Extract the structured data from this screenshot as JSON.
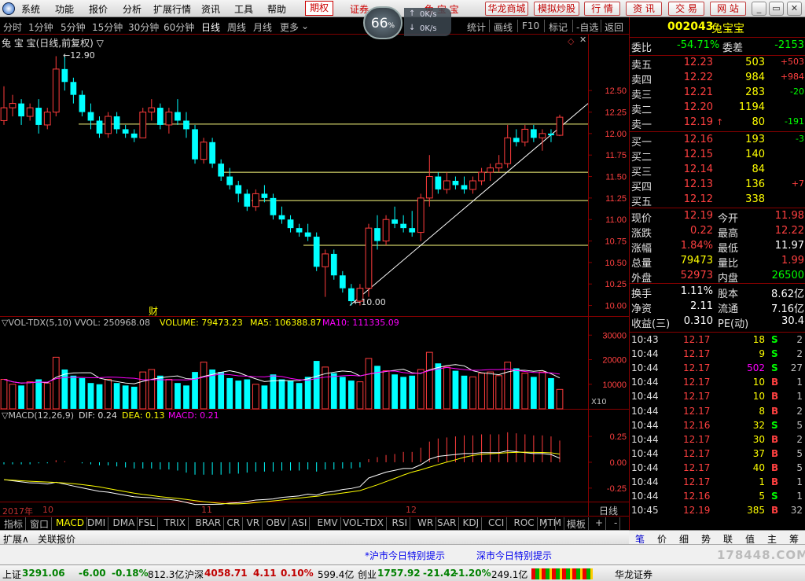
{
  "menu": [
    "系统",
    "功能",
    "报价",
    "分析",
    "扩展行情",
    "资讯",
    "工具",
    "帮助"
  ],
  "menu_highlight": "期权",
  "menu_scroll": "证券",
  "menu_stock": "兔 宝 宝",
  "top_buttons": [
    "华龙商城",
    "模拟炒股",
    "行 情",
    "资 讯",
    "交 易",
    "网 站"
  ],
  "speed": {
    "percent": "66",
    "unit": "%",
    "up": "0K/s",
    "down": "0K/s",
    "tip": "模拟"
  },
  "periods": [
    "分时",
    "1分钟",
    "5分钟",
    "15分钟",
    "30分钟",
    "60分钟",
    "日线",
    "周线",
    "月线",
    "更多"
  ],
  "period_active": "日线",
  "right_tools": [
    "统计",
    "画线",
    "F10",
    "标记",
    "-自选",
    "返回"
  ],
  "chart_title": "兔 宝 宝(日线,前复权) ▽",
  "price_hi_label": "12.90",
  "price_lo_label": "10.00",
  "fin_mark": "财",
  "vol_title": {
    "a": "▽VOL-TDX(5,10) VVOL: 250968.08",
    "b": "VOLUME: 79473.23",
    "c": "MA5: 106388.87",
    "d": "MA10: 111335.09"
  },
  "vol_unit": "X10",
  "macd_title": {
    "a": "▽MACD(12,26,9)",
    "b": "DIF: 0.24",
    "c": "DEA: 0.13",
    "d": "MACD: 0.21"
  },
  "date_labels": {
    "year": "2017年",
    "m1": "10",
    "m2": "11",
    "m3": "12"
  },
  "timeframe_label": "日线",
  "chart_data": [
    {
      "type": "candlestick",
      "y_ticks": [
        "12.50",
        "12.25",
        "12.00",
        "11.75",
        "11.50",
        "11.25",
        "11.00",
        "10.75",
        "10.50",
        "10.25",
        "10.00"
      ],
      "ylim": [
        9.95,
        12.95
      ],
      "candles": [
        [
          12.15,
          12.55,
          12.1,
          12.3
        ],
        [
          12.3,
          12.45,
          12.2,
          12.35
        ],
        [
          12.35,
          12.4,
          12.1,
          12.2
        ],
        [
          12.2,
          12.35,
          12.15,
          12.3
        ],
        [
          12.3,
          12.4,
          12.0,
          12.1
        ],
        [
          12.1,
          12.3,
          12.05,
          12.25
        ],
        [
          12.25,
          12.9,
          12.2,
          12.75
        ],
        [
          12.75,
          12.9,
          12.5,
          12.6
        ],
        [
          12.6,
          12.65,
          12.35,
          12.45
        ],
        [
          12.45,
          12.5,
          12.2,
          12.25
        ],
        [
          12.25,
          12.35,
          12.05,
          12.15
        ],
        [
          12.15,
          12.2,
          11.95,
          12.0
        ],
        [
          12.0,
          12.25,
          11.95,
          12.2
        ],
        [
          12.2,
          12.25,
          12.0,
          12.05
        ],
        [
          12.05,
          12.1,
          11.95,
          12.0
        ],
        [
          12.0,
          12.05,
          11.9,
          11.95
        ],
        [
          11.95,
          12.3,
          11.95,
          12.25
        ],
        [
          12.25,
          12.4,
          12.15,
          12.3
        ],
        [
          12.3,
          12.35,
          12.05,
          12.1
        ],
        [
          12.1,
          12.3,
          12.0,
          12.25
        ],
        [
          12.25,
          12.4,
          12.1,
          12.15
        ],
        [
          12.15,
          12.25,
          11.95,
          12.05
        ],
        [
          12.05,
          12.1,
          11.65,
          11.7
        ],
        [
          11.7,
          11.95,
          11.65,
          11.9
        ],
        [
          11.9,
          11.95,
          11.6,
          11.65
        ],
        [
          11.65,
          11.7,
          11.45,
          11.5
        ],
        [
          11.5,
          11.6,
          11.35,
          11.4
        ],
        [
          11.4,
          11.45,
          11.2,
          11.3
        ],
        [
          11.3,
          11.35,
          11.1,
          11.15
        ],
        [
          11.15,
          11.35,
          11.1,
          11.3
        ],
        [
          11.3,
          11.4,
          11.2,
          11.25
        ],
        [
          11.25,
          11.3,
          11.0,
          11.05
        ],
        [
          11.05,
          11.15,
          10.95,
          11.0
        ],
        [
          11.0,
          11.05,
          10.85,
          10.9
        ],
        [
          10.9,
          10.95,
          10.8,
          10.85
        ],
        [
          10.85,
          10.95,
          10.75,
          10.8
        ],
        [
          10.8,
          10.85,
          10.4,
          10.45
        ],
        [
          10.45,
          10.65,
          10.1,
          10.6
        ],
        [
          10.6,
          10.65,
          10.3,
          10.35
        ],
        [
          10.35,
          10.4,
          10.15,
          10.2
        ],
        [
          10.2,
          10.25,
          10.0,
          10.05
        ],
        [
          10.05,
          10.25,
          10.0,
          10.2
        ],
        [
          10.2,
          10.95,
          10.1,
          10.9
        ],
        [
          10.9,
          11.05,
          10.65,
          10.75
        ],
        [
          10.75,
          11.05,
          10.7,
          11.0
        ],
        [
          11.0,
          11.15,
          10.9,
          10.95
        ],
        [
          10.95,
          11.05,
          10.85,
          10.9
        ],
        [
          10.9,
          11.1,
          10.8,
          10.85
        ],
        [
          10.85,
          11.3,
          10.75,
          11.25
        ],
        [
          11.25,
          11.75,
          11.15,
          11.5
        ],
        [
          11.5,
          11.55,
          11.3,
          11.35
        ],
        [
          11.35,
          11.55,
          11.3,
          11.45
        ],
        [
          11.45,
          11.5,
          11.35,
          11.4
        ],
        [
          11.4,
          11.5,
          11.3,
          11.35
        ],
        [
          11.35,
          11.5,
          11.3,
          11.45
        ],
        [
          11.45,
          11.6,
          11.4,
          11.55
        ],
        [
          11.55,
          11.65,
          11.45,
          11.6
        ],
        [
          11.6,
          11.75,
          11.55,
          11.65
        ],
        [
          11.65,
          12.1,
          11.6,
          11.95
        ],
        [
          11.95,
          12.05,
          11.85,
          11.9
        ],
        [
          11.9,
          12.1,
          11.85,
          12.05
        ],
        [
          12.05,
          12.1,
          11.9,
          11.95
        ],
        [
          11.95,
          12.05,
          11.8,
          12.0
        ],
        [
          12.0,
          12.05,
          11.9,
          11.98
        ],
        [
          11.98,
          12.22,
          11.97,
          12.19
        ]
      ],
      "hlines": [
        12.11,
        11.55,
        11.22,
        10.7
      ]
    },
    {
      "type": "bar",
      "name": "VOL",
      "y_ticks": [
        "30000",
        "20000",
        "10000"
      ],
      "ylim": [
        0,
        32000
      ],
      "values": [
        1.2,
        1.0,
        0.95,
        1.1,
        1.2,
        1.05,
        2.1,
        1.6,
        1.35,
        1.25,
        1.05,
        1.0,
        1.2,
        1.05,
        0.95,
        0.9,
        1.5,
        1.6,
        1.35,
        1.2,
        1.05,
        0.95,
        1.5,
        1.9,
        1.6,
        1.5,
        1.25,
        1.15,
        1.2,
        1.0,
        0.95,
        1.4,
        1.2,
        1.15,
        1.05,
        1.3,
        1.95,
        1.7,
        1.45,
        1.3,
        1.15,
        1.1,
        2.05,
        1.75,
        1.55,
        1.4,
        1.3,
        1.35,
        1.6,
        2.3,
        1.85,
        1.7,
        1.55,
        1.35,
        1.3,
        1.45,
        1.5,
        1.35,
        1.9,
        1.65,
        1.45,
        1.3,
        1.5,
        1.25,
        0.79
      ]
    },
    {
      "type": "bar",
      "name": "MACD",
      "y_ticks": [
        "0.25",
        "0.00",
        "-0.25"
      ],
      "ylim": [
        -0.35,
        0.38
      ],
      "values": [
        -0.02,
        -0.02,
        -0.02,
        -0.02,
        -0.01,
        -0.01,
        0.02,
        0.01,
        0.0,
        -0.01,
        -0.02,
        -0.03,
        -0.03,
        -0.04,
        -0.05,
        -0.06,
        -0.06,
        -0.06,
        -0.07,
        -0.07,
        -0.08,
        -0.1,
        -0.12,
        -0.12,
        -0.12,
        -0.12,
        -0.11,
        -0.11,
        -0.1,
        -0.09,
        -0.09,
        -0.09,
        -0.08,
        -0.08,
        -0.08,
        -0.07,
        -0.09,
        -0.07,
        -0.07,
        -0.06,
        -0.06,
        -0.05,
        0.03,
        0.05,
        0.07,
        0.08,
        0.1,
        0.1,
        0.14,
        0.2,
        0.23,
        0.24,
        0.25,
        0.26,
        0.26,
        0.27,
        0.27,
        0.27,
        0.29,
        0.28,
        0.27,
        0.26,
        0.26,
        0.25,
        0.21
      ]
    }
  ],
  "quote": {
    "code": "002043",
    "name": "兔宝宝",
    "wb_label": "委比",
    "wb": "-54.71%",
    "wc_label": "委差",
    "wc": "-2153",
    "asks": [
      [
        "卖五",
        "12.23",
        "503",
        "+503"
      ],
      [
        "卖四",
        "12.22",
        "984",
        "+984"
      ],
      [
        "卖三",
        "12.21",
        "283",
        "-20"
      ],
      [
        "卖二",
        "12.20",
        "1194",
        ""
      ],
      [
        "卖一",
        "12.19",
        "80",
        "-191"
      ]
    ],
    "bids": [
      [
        "买一",
        "12.16",
        "193",
        "-3"
      ],
      [
        "买二",
        "12.15",
        "140",
        ""
      ],
      [
        "买三",
        "12.14",
        "84",
        ""
      ],
      [
        "买四",
        "12.13",
        "136",
        "+7"
      ],
      [
        "买五",
        "12.12",
        "338",
        ""
      ]
    ],
    "stats": [
      [
        "现价",
        "12.19",
        "今开",
        "11.98"
      ],
      [
        "涨跌",
        "0.22",
        "最高",
        "12.22"
      ],
      [
        "涨幅",
        "1.84%",
        "最低",
        "11.97"
      ],
      [
        "总量",
        "79473",
        "量比",
        "1.99"
      ],
      [
        "外盘",
        "52973",
        "内盘",
        "26500"
      ]
    ],
    "stats2": [
      [
        "换手",
        "1.11%",
        "股本",
        "8.62亿"
      ],
      [
        "净资",
        "2.11",
        "流通",
        "7.16亿"
      ],
      [
        "收益(三)",
        "0.310",
        "PE(动)",
        "30.4"
      ]
    ]
  },
  "ticks": [
    [
      "10:43",
      "12.17",
      "18",
      "S",
      "2"
    ],
    [
      "10:44",
      "12.17",
      "9",
      "S",
      "2"
    ],
    [
      "10:44",
      "12.17",
      "502",
      "S",
      "27"
    ],
    [
      "10:44",
      "12.17",
      "10",
      "B",
      "1"
    ],
    [
      "10:44",
      "12.17",
      "10",
      "B",
      "1"
    ],
    [
      "10:44",
      "12.17",
      "8",
      "B",
      "2"
    ],
    [
      "10:44",
      "12.16",
      "32",
      "S",
      "5"
    ],
    [
      "10:44",
      "12.17",
      "30",
      "B",
      "2"
    ],
    [
      "10:44",
      "12.17",
      "37",
      "B",
      "5"
    ],
    [
      "10:44",
      "12.17",
      "40",
      "B",
      "5"
    ],
    [
      "10:44",
      "12.17",
      "1",
      "B",
      "1"
    ],
    [
      "10:44",
      "12.16",
      "5",
      "S",
      "1"
    ],
    [
      "10:45",
      "12.19",
      "385",
      "B",
      "32"
    ]
  ],
  "indicator_tabs": [
    "指标",
    "窗口",
    "MACD",
    "DMI",
    "DMA",
    "FSL",
    "TRIX",
    "BRAR",
    "CR",
    "VR",
    "OBV",
    "ASI",
    "EMV",
    "VOL-TDX",
    "RSI",
    "WR",
    "SAR",
    "KDJ",
    "CCI",
    "ROC",
    "MTM"
  ],
  "tab_extra": [
    "模板",
    "+",
    "-"
  ],
  "right_tabs": [
    "笔",
    "价",
    "细",
    "势",
    "联",
    "值",
    "主",
    "筹"
  ],
  "ext_tabs": [
    "扩展∧",
    "关联报价"
  ],
  "notices": [
    "*沪市今日特别提示",
    "深市今日特别提示"
  ],
  "status": {
    "sh_label": "上证",
    "sh": "3291.06",
    "sh_chg": "-6.00",
    "sh_pct": "-0.18%",
    "sh_amt": "812.3亿",
    "sz_label": "沪深",
    "sz": "4058.71",
    "sz_chg": "4.11",
    "sz_pct": "0.10%",
    "sz_amt": "599.4亿",
    "cy_label": "创业",
    "cy": "1757.92",
    "cy_chg": "-21.42",
    "cy_pct": "-1.20%",
    "cy_amt": "249.1亿",
    "broker": "华龙证券"
  },
  "watermark": "178448.COM",
  "colors": {
    "up": "#ff3c3c",
    "down": "#00ffff",
    "yellow": "#ffff00",
    "white": "#ffffff",
    "grid": "#880000",
    "purple": "#ff00ff"
  }
}
